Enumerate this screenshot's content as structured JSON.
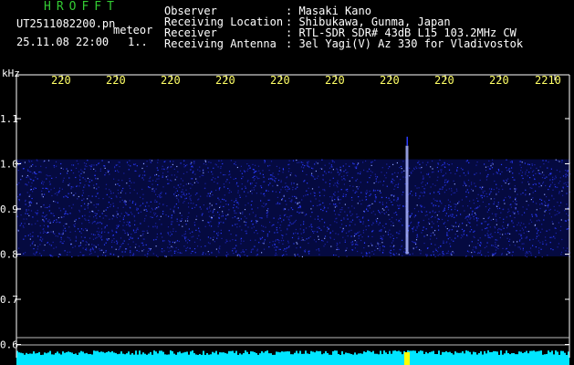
{
  "header": {
    "app_title": "HROFFT",
    "file_name": "UT2511082200.pn",
    "event_label": "meteor",
    "datetime": "25.11.08 22:00",
    "counter": "1..",
    "info": [
      {
        "key": "Observer",
        "value": ": Masaki Kano"
      },
      {
        "key": "Receiving Location",
        "value": ": Shibukawa, Gunma, Japan"
      },
      {
        "key": "Receiver",
        "value": ": RTL-SDR SDR# 43dB L15 103.2MHz CW"
      },
      {
        "key": "Receiving Antenna",
        "value": ": 3el Yagi(V) Az 330 for Vladivostok"
      }
    ]
  },
  "chart_data": {
    "type": "heatmap",
    "ylabel": "kHz",
    "x_ticks": [
      "220",
      "220",
      "220",
      "220",
      "220",
      "220",
      "220",
      "220",
      "220",
      "2210"
    ],
    "y_ticks": [
      "1.1",
      "1.0",
      "0.9",
      "0.8",
      "0.7",
      "0.6"
    ],
    "ylim": [
      0.57,
      1.17
    ],
    "noise_band_khz": [
      0.795,
      1.01
    ],
    "meteor_echo": {
      "x_minute": 2206.3,
      "freq_khz": [
        0.8,
        1.04
      ]
    },
    "grid": false,
    "colors": {
      "background": "#000000",
      "axis": "#ffffff",
      "x_tick_text": "#ffff66",
      "noise": "#2a3cff",
      "echo": "#aab4ff",
      "level_trace": "#00e5ff",
      "marker": "#ffff00"
    }
  }
}
